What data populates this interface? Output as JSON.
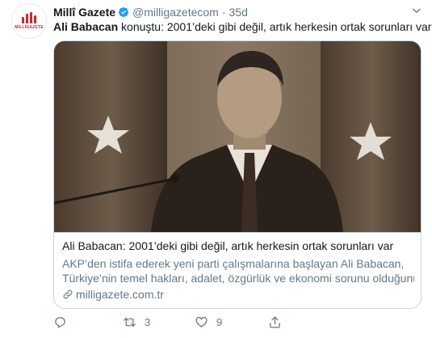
{
  "tweet": {
    "author_name": "Millî Gazete",
    "handle": "@milligazetecom",
    "separator": "·",
    "time": "35d",
    "text_bold": "Ali Babacan",
    "text_rest": " konuştu: 2001’deki gibi değil, artık herkesin ortak sorunları var",
    "avatar_text": "MİLLİGAZETE"
  },
  "card": {
    "title": "Ali Babacan: 2001’deki gibi değil, artık herkesin ortak sorunları var",
    "desc_line1": "AKP’den istifa ederek yeni parti çalışmalarına başlayan Ali Babacan,",
    "desc_line2": "Türkiye’nin temel hakları, adalet, özgürlük ve ekonomi sorunu olduğunu …",
    "url": "milligazete.com.tr"
  },
  "actions": {
    "reply_count": "",
    "retweet_count": "3",
    "like_count": "9"
  },
  "colors": {
    "verified": "#1da1f2",
    "secondary_text": "#657786",
    "brand_red": "#d2232a"
  }
}
